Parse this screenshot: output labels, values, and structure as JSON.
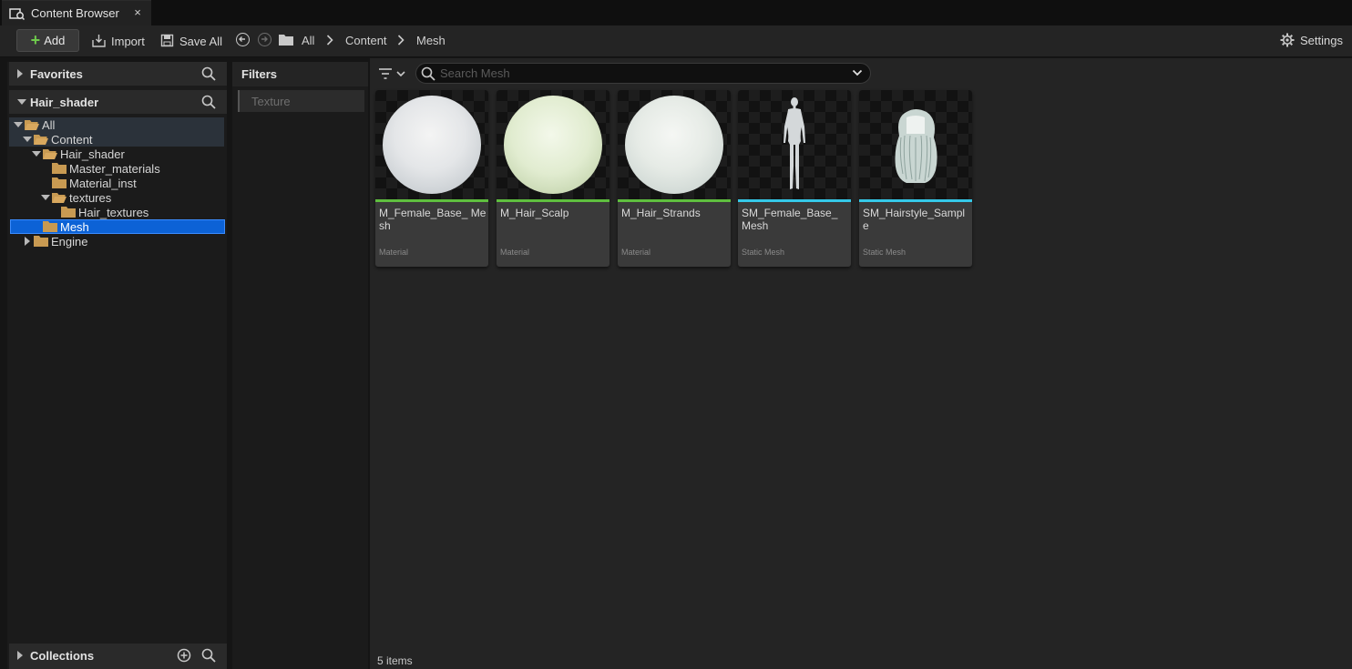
{
  "tab": {
    "title": "Content Browser",
    "close": "×"
  },
  "toolbar": {
    "add_label": "Add",
    "import_label": "Import",
    "save_all_label": "Save All",
    "settings_label": "Settings",
    "breadcrumb": [
      "All",
      "Content",
      "Mesh"
    ]
  },
  "sources": {
    "favorites_label": "Favorites",
    "project_label": "Hair_shader",
    "collections_label": "Collections",
    "tree": [
      {
        "label": "All",
        "depth": 0,
        "expanded": true
      },
      {
        "label": "Content",
        "depth": 1,
        "expanded": true
      },
      {
        "label": "Hair_shader",
        "depth": 2,
        "expanded": true
      },
      {
        "label": "Master_materials",
        "depth": 3
      },
      {
        "label": "Material_inst",
        "depth": 3
      },
      {
        "label": "textures",
        "depth": 3,
        "expanded": true
      },
      {
        "label": "Hair_textures",
        "depth": 4
      },
      {
        "label": "Mesh",
        "depth": 2,
        "selected": true
      },
      {
        "label": "Engine",
        "depth": 1,
        "expanded": false
      }
    ]
  },
  "filters": {
    "header": "Filters",
    "chip": "Texture"
  },
  "search": {
    "placeholder": "Search Mesh",
    "value": ""
  },
  "assets": [
    {
      "name": "M_Female_Base_ Mesh",
      "kind": "Material",
      "type_color": "#5fbf3f"
    },
    {
      "name": "M_Hair_Scalp",
      "kind": "Material",
      "type_color": "#5fbf3f"
    },
    {
      "name": "M_Hair_Strands",
      "kind": "Material",
      "type_color": "#5fbf3f"
    },
    {
      "name": "SM_Female_Base_ Mesh",
      "kind": "Static Mesh",
      "type_color": "#35c8e8"
    },
    {
      "name": "SM_Hairstyle_Sample",
      "kind": "Static Mesh",
      "type_color": "#35c8e8"
    }
  ],
  "status": {
    "item_count": "5 items"
  },
  "colors": {
    "accent_selection": "#0c62d6",
    "add_plus": "#6fca4c"
  }
}
